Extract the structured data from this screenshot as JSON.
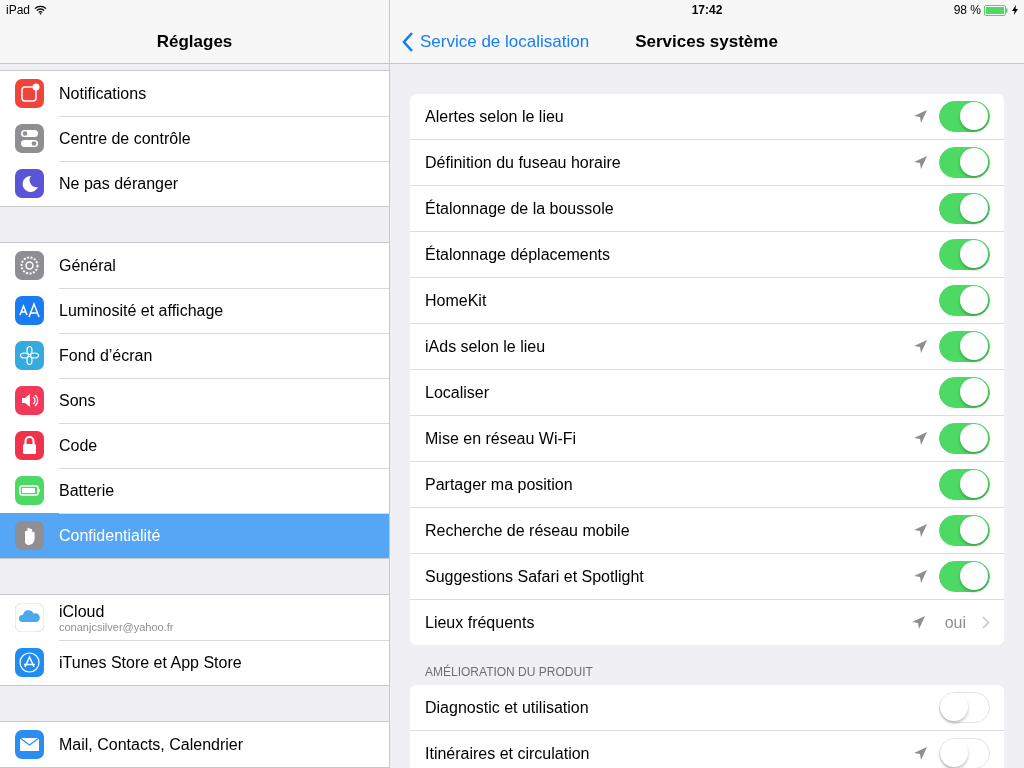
{
  "status_bar": {
    "device": "iPad",
    "time": "17:42",
    "battery": "98 %",
    "charging": true
  },
  "sidebar": {
    "title": "Réglages",
    "groups": [
      {
        "items": [
          {
            "label": "Notifications",
            "color": "#f0433a",
            "selected": false
          },
          {
            "label": "Centre de contrôle",
            "color": "#8e8e93",
            "selected": false
          },
          {
            "label": "Ne pas déranger",
            "color": "#5856d6",
            "selected": false
          }
        ]
      },
      {
        "items": [
          {
            "label": "Général",
            "color": "#8e8e93",
            "selected": false
          },
          {
            "label": "Luminosité et affichage",
            "color": "#1a7cf5",
            "selected": false
          },
          {
            "label": "Fond d’écran",
            "color": "#35aadc",
            "selected": false
          },
          {
            "label": "Sons",
            "color": "#f2395a",
            "selected": false
          },
          {
            "label": "Code",
            "color": "#f0334a",
            "selected": false
          },
          {
            "label": "Batterie",
            "color": "#4cd964",
            "selected": false
          },
          {
            "label": "Confidentialité",
            "color": "#8e8e93",
            "selected": true
          }
        ]
      },
      {
        "items": [
          {
            "label": "iCloud",
            "sublabel": "conanjcsilver@yahoo.fr",
            "color": "#ffffff",
            "selected": false
          },
          {
            "label": "iTunes Store et App Store",
            "color": "#1e8cf0",
            "selected": false
          }
        ]
      },
      {
        "items": [
          {
            "label": "Mail, Contacts, Calendrier",
            "color": "#2a8ef0",
            "selected": false
          }
        ]
      }
    ]
  },
  "nav": {
    "back": "Service de localisation",
    "title": "Services système"
  },
  "sections": [
    {
      "rows": [
        {
          "kind": "switch",
          "label": "Alertes selon le lieu",
          "location_icon": true,
          "on": true
        },
        {
          "kind": "switch",
          "label": "Définition du fuseau horaire",
          "location_icon": true,
          "on": true
        },
        {
          "kind": "switch",
          "label": "Étalonnage de la boussole",
          "location_icon": false,
          "on": true
        },
        {
          "kind": "switch",
          "label": "Étalonnage déplacements",
          "location_icon": false,
          "on": true
        },
        {
          "kind": "switch",
          "label": "HomeKit",
          "location_icon": false,
          "on": true
        },
        {
          "kind": "switch",
          "label": "iAds selon le lieu",
          "location_icon": true,
          "on": true
        },
        {
          "kind": "switch",
          "label": "Localiser",
          "location_icon": false,
          "on": true
        },
        {
          "kind": "switch",
          "label": "Mise en réseau Wi-Fi",
          "location_icon": true,
          "on": true
        },
        {
          "kind": "switch",
          "label": "Partager ma position",
          "location_icon": false,
          "on": true
        },
        {
          "kind": "switch",
          "label": "Recherche de réseau mobile",
          "location_icon": true,
          "on": true
        },
        {
          "kind": "switch",
          "label": "Suggestions Safari et Spotlight",
          "location_icon": true,
          "on": true
        },
        {
          "kind": "link",
          "label": "Lieux fréquents",
          "location_icon": true,
          "value": "oui"
        }
      ]
    },
    {
      "header": "AMÉLIORATION DU PRODUIT",
      "rows": [
        {
          "kind": "switch",
          "label": "Diagnostic et utilisation",
          "location_icon": false,
          "on": false
        },
        {
          "kind": "switch",
          "label": "Itinéraires et circulation",
          "location_icon": true,
          "on": false
        }
      ]
    }
  ]
}
